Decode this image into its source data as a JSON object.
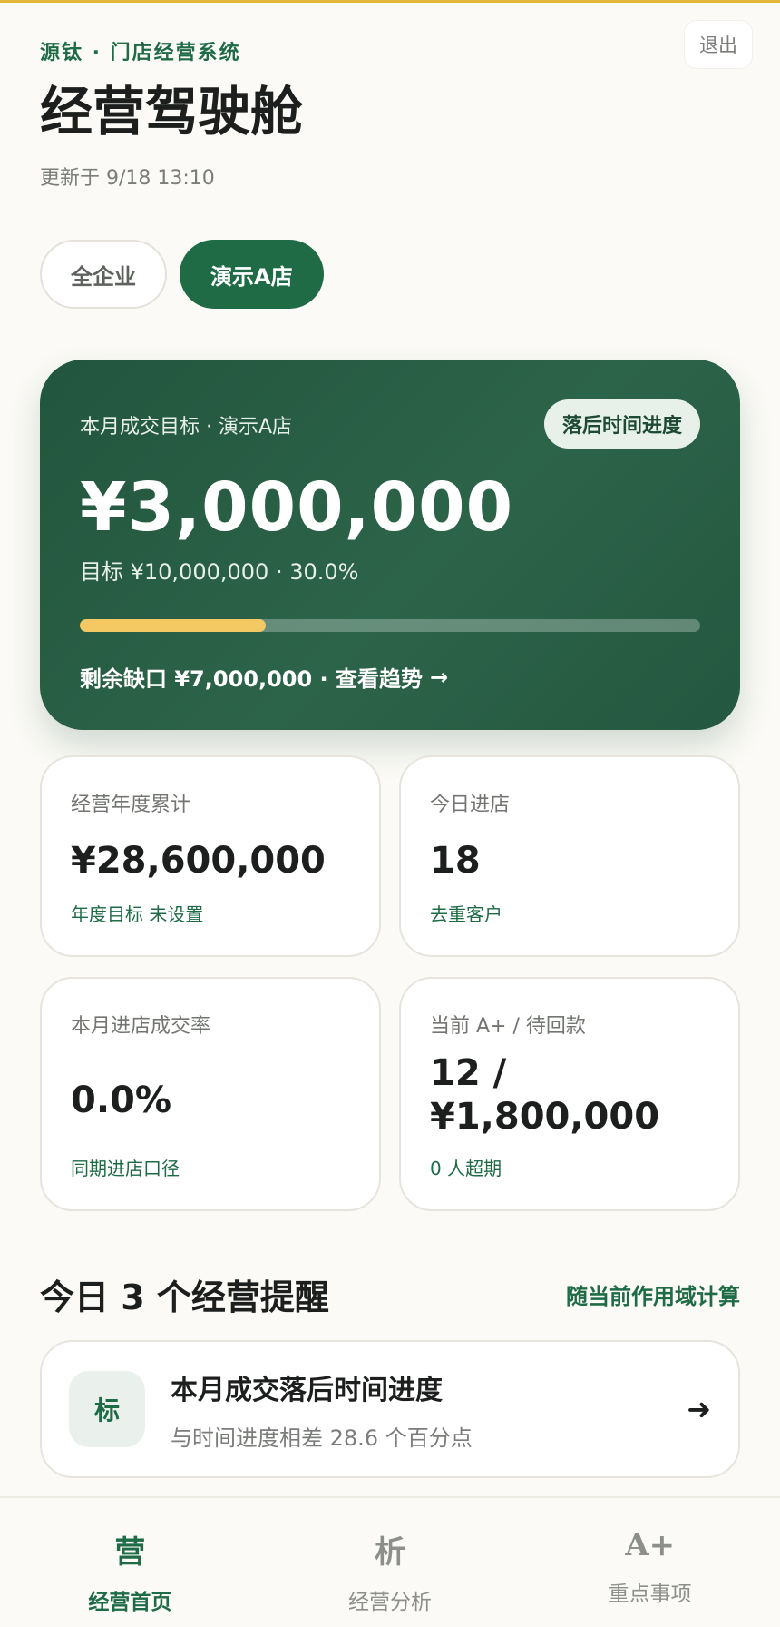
{
  "header": {
    "brand": "源钛 · 门店经营系统",
    "title": "经营驾驶舱",
    "updated": "更新于 9/18 13:10",
    "logout_label": "退出"
  },
  "scope_tabs": [
    {
      "label": "全企业",
      "active": false
    },
    {
      "label": "演示A店",
      "active": true
    }
  ],
  "hero": {
    "label": "本月成交目标 · 演示A店",
    "badge": "落后时间进度",
    "amount": "¥3,000,000",
    "sub": "目标 ¥10,000,000 · 30.0%",
    "progress": 0.3,
    "gap_text": "剩余缺口 ¥7,000,000 · 查看趋势",
    "arrow": "→"
  },
  "kpis": [
    {
      "label": "经营年度累计",
      "value": "¥28,600,000",
      "note": "年度目标 未设置"
    },
    {
      "label": "今日进店",
      "value": "18",
      "note": "去重客户"
    },
    {
      "label": "本月进店成交率",
      "value": "0.0%",
      "note": "同期进店口径"
    },
    {
      "label": "当前 A+ / 待回款",
      "value": "12 / ¥1,800,000",
      "note": "0 人超期"
    }
  ],
  "reminders": {
    "title": "今日 3 个经营提醒",
    "note": "随当前作用域计算",
    "items": [
      {
        "icon_text": "标",
        "title": "本月成交落后时间进度",
        "sub": "与时间进度相差 28.6 个百分点",
        "arrow": "➜"
      }
    ]
  },
  "bottom_nav": [
    {
      "glyph": "营",
      "label": "经营首页",
      "active": true
    },
    {
      "glyph": "析",
      "label": "经营分析",
      "active": false
    },
    {
      "glyph": "A+",
      "label": "重点事项",
      "active": false
    }
  ],
  "colors": {
    "accent": "#1e6b46",
    "hero_bg": "#2a5e45",
    "progress": "#f4c862",
    "top_line": "#e0b73a"
  }
}
